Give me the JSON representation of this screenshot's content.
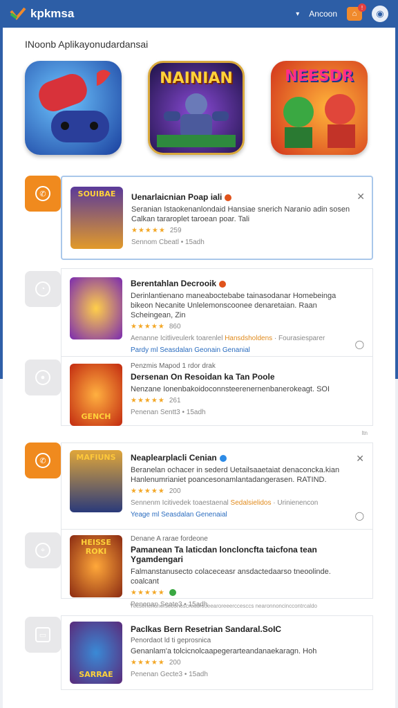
{
  "header": {
    "logo_text": "kpkmsa",
    "nav_label": "Ancoon",
    "notification_count": "!"
  },
  "section": {
    "heading": "INoonb Aplikayonudardansai"
  },
  "featured": [
    {
      "title": "",
      "icon": "gamepad-icon"
    },
    {
      "title": "NAINIAN",
      "icon": "robot-icon"
    },
    {
      "title": "NEESDR",
      "icon": "fighters-icon"
    }
  ],
  "group1": {
    "items": [
      {
        "title": "Uenarlaicnian Poap iali",
        "thumb_caption": "SOUIBAE",
        "desc": "Seranian Istaokenanlondaid Hansiae snerich Naranio adin sosen Calkan tararoplet taroean poar. Tali",
        "rating_count": "259",
        "meta": "Sennom Cbeatl • 15adh"
      }
    ]
  },
  "group2": {
    "items": [
      {
        "title": "Berentahlan Decrooik",
        "desc": "Derinlantienano maneaboctebabe tainasodanar Homebeinga bikeon Necanite Unlelemonscoonee denaretaian. Raan Scheingean, Zin",
        "rating_count": "860",
        "meta_left": "Aenanne Icitliveulerk toarenlel",
        "meta_hl": "Hansdsholdens",
        "meta_right": "Fourasiesparer",
        "link": "Pardy ml Seasdalan Geonain Genanial"
      },
      {
        "pre": "Penzmis Mapod 1 rdor drak",
        "title": "Dersenan On Resoidan ka Tan Poole",
        "thumb_caption": "GENCH",
        "desc": "Nenzane Ionenbakoidoconnsteerenernenbanerokeagt. SOI",
        "rating_count": "261",
        "meta": "Penenan Sentt3 • 15adh"
      }
    ],
    "footer_note": "ltn"
  },
  "group3": {
    "items": [
      {
        "title": "Neaplearplacli Cenian",
        "thumb_caption": "MAFIUNS",
        "desc": "Beranelan ochacer in sederd Uetailsaaetaiat denaconcka.kian Hanlenumrianiet poancesonamlantadangerasen. RATIND.",
        "rating_count": "200",
        "meta_left": "Sennenm Icitivedek toaestaenal",
        "meta_hl": "Sedalsielidos",
        "meta_right": "Urinienencon",
        "link": "Yeage ml Seasdalan Genenaial"
      },
      {
        "pre": "Denane A rarae fordeone",
        "title": "Pamanean Ta laticdan loncloncfta taicfona tean Ygamdengari",
        "thumb_caption": "HEISSE ROKI",
        "desc": "Falmanstanusecto colaceceasr ansdactedaarso tneoolinde. coalcant",
        "rating_count": "",
        "meta": "Penenan Seate3 • 15adh"
      }
    ],
    "footer_note": "Yecsenenonerseconoscreaorsoeearoreeerccesccs nearonnoncinccontrcaldo"
  },
  "group4": {
    "items": [
      {
        "title": "Paclkas Bern Resetrian Sandaral.SoIC",
        "thumb_caption": "SARRAE",
        "pre": "Penordaot ld ti geprosnica",
        "desc": "Genanlam'a tolcicnolcaapegerarteandanaekaragn. Hoh",
        "rating_count": "200",
        "meta": "Penenan Gecte3 • 15adh"
      }
    ]
  },
  "colors": {
    "header_bg": "#2d5ea6",
    "accent_orange": "#f08a1e",
    "link_blue": "#2a6cbf",
    "star": "#f3a726"
  }
}
